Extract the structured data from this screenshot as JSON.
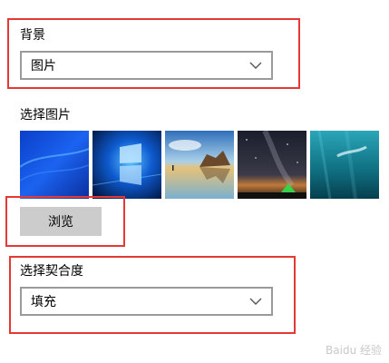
{
  "background": {
    "label": "背景",
    "value": "图片"
  },
  "picture_picker": {
    "label": "选择图片",
    "thumbnails": [
      {
        "name": "windows-blue-abstract"
      },
      {
        "name": "windows-10-logo-light"
      },
      {
        "name": "beach-rock-formation"
      },
      {
        "name": "starry-night-tent"
      },
      {
        "name": "underwater-swimmer"
      }
    ],
    "browse_label": "浏览"
  },
  "fit": {
    "label": "选择契合度",
    "value": "填充"
  },
  "colors": {
    "highlight": "#e53935",
    "dropdown_border": "#9a9a9a",
    "button_bg": "#cccccc"
  },
  "watermark": "Baidu 经验"
}
